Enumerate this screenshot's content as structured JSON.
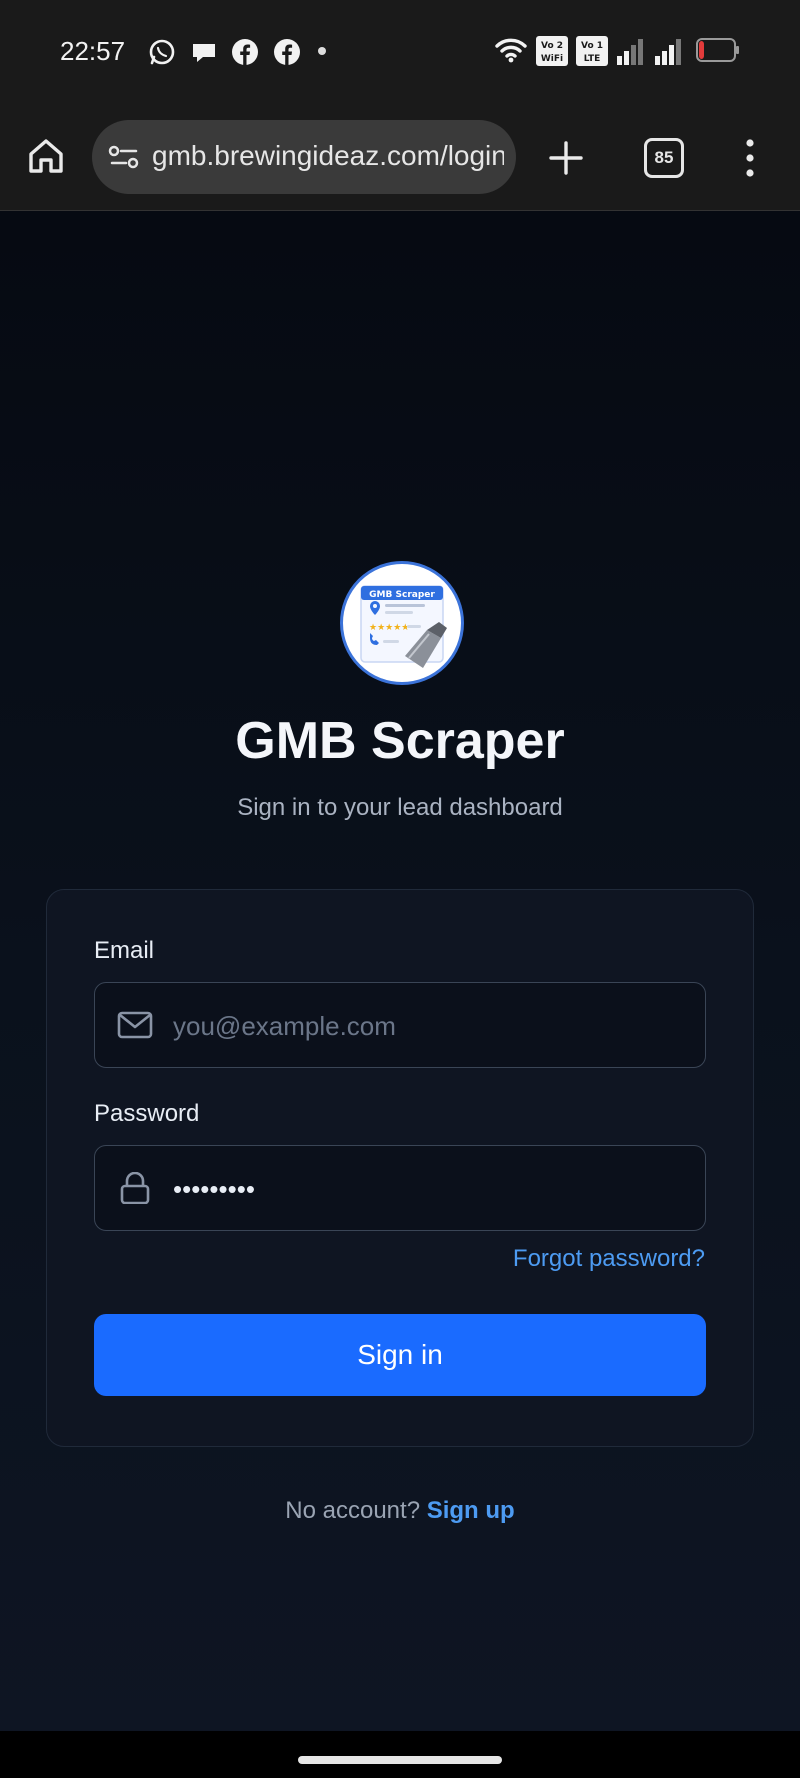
{
  "status_bar": {
    "time": "22:57",
    "notification_icons": [
      "whatsapp-icon",
      "chat-bubble-icon",
      "facebook-icon",
      "facebook-icon"
    ],
    "network_labels": {
      "sim1_top": "Vo 2",
      "sim1_bottom": "WiFi",
      "sim2_top": "Vo 1",
      "sim2_bottom": "LTE"
    },
    "battery_level": 0.15,
    "battery_color": "#e23b3b"
  },
  "browser": {
    "url": "gmb.brewingideaz.com/login",
    "tab_count": "85"
  },
  "app": {
    "logo_text": "GMB Scraper",
    "title": "GMB Scraper",
    "subtitle": "Sign in to your lead dashboard"
  },
  "form": {
    "email_label": "Email",
    "email_placeholder": "you@example.com",
    "email_value": "",
    "password_label": "Password",
    "password_value": "•••••••••",
    "forgot_link": "Forgot password?",
    "submit_label": "Sign in"
  },
  "footer": {
    "prompt": "No account?",
    "signup_link": "Sign up"
  },
  "colors": {
    "accent": "#1a6bff",
    "link": "#4d9bf2",
    "background": "#0b111b"
  }
}
